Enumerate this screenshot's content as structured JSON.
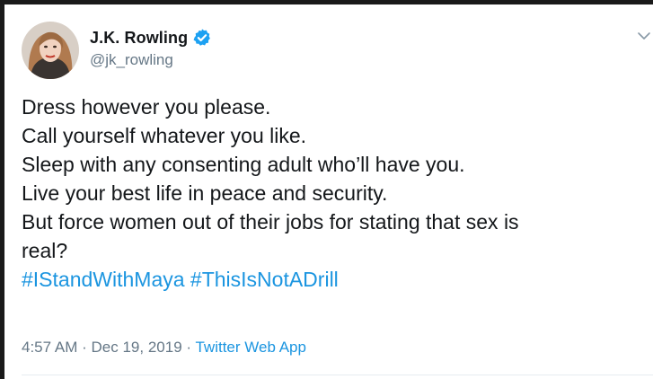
{
  "tweet": {
    "author": {
      "display_name": "J.K. Rowling",
      "handle": "@jk_rowling",
      "verified": true
    },
    "text_lines": [
      "Dress however you please.",
      "Call yourself whatever you like.",
      "Sleep with any consenting adult who’ll have you.",
      "Live your best life in peace and security.",
      "But force women out of their jobs for stating that sex is",
      "real?"
    ],
    "hashtags": [
      "#IStandWithMaya",
      "#ThisIsNotADrill"
    ],
    "time": "4:57 AM",
    "separator": "·",
    "date": "Dec 19, 2019",
    "source": "Twitter Web App"
  },
  "colors": {
    "link": "#1b95e0",
    "verified_badge": "#1da1f2",
    "secondary_text": "#657786",
    "primary_text": "#14171a"
  },
  "icons": {
    "verified": "verified-badge-icon",
    "menu": "chevron-down-icon"
  }
}
